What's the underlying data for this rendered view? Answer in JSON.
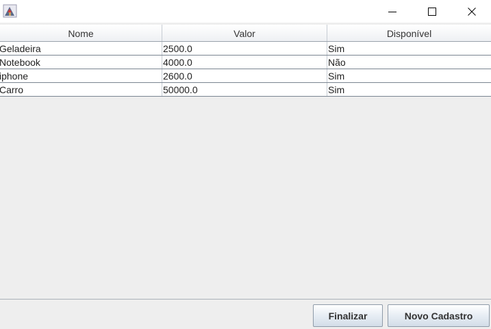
{
  "window": {
    "title_icon": "java-app-icon",
    "controls": [
      "minimize-icon",
      "maximize-icon",
      "close-icon"
    ]
  },
  "table": {
    "columns": [
      "Nome",
      "Valor",
      "Disponível"
    ],
    "rows": [
      [
        "Geladeira",
        "2500.0",
        "Sim"
      ],
      [
        "Notebook",
        "4000.0",
        "Não"
      ],
      [
        "iphone",
        "2600.0",
        "Sim"
      ],
      [
        "Carro",
        "50000.0",
        "Sim"
      ]
    ]
  },
  "buttons": {
    "finalizar": "Finalizar",
    "novo_cadastro": "Novo Cadastro"
  }
}
